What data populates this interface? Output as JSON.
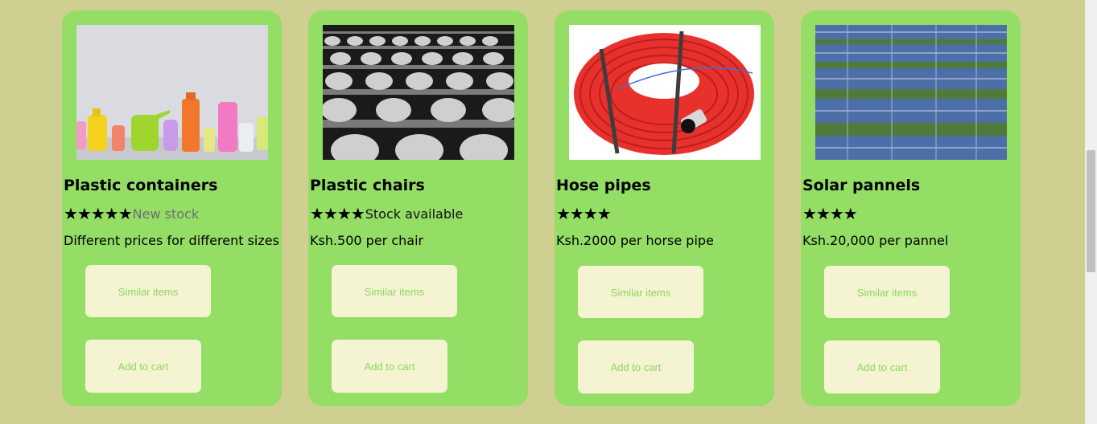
{
  "colors": {
    "page_bg": "#cfcf91",
    "card_bg": "#94de66",
    "button_bg": "#f4f4d2",
    "button_text": "#8ed660",
    "muted_text": "#6f6f6f"
  },
  "products": [
    {
      "title": "Plastic containers",
      "stars": "★★★★★",
      "star_count": 5,
      "stock": "New stock",
      "stock_muted": true,
      "price": "Different prices for different sizes",
      "similar_label": "Similar items",
      "cart_label": "Add to cart",
      "image": "plastic-containers-photo"
    },
    {
      "title": "Plastic chairs",
      "stars": "★★★★",
      "star_count": 4,
      "stock": "Stock available",
      "stock_muted": false,
      "price": "Ksh.500 per chair",
      "similar_label": "Similar items",
      "cart_label": "Add to cart",
      "image": "plastic-chairs-photo"
    },
    {
      "title": "Hose pipes",
      "stars": "★★★★",
      "star_count": 4,
      "stock": "",
      "stock_muted": false,
      "price": "Ksh.2000 per horse pipe",
      "similar_label": "Similar items",
      "cart_label": "Add to cart",
      "image": "hose-pipe-photo"
    },
    {
      "title": "Solar pannels",
      "stars": "★★★★",
      "star_count": 4,
      "stock": "",
      "stock_muted": false,
      "price": "Ksh.20,000 per pannel",
      "similar_label": "Similar items",
      "cart_label": "Add to cart",
      "image": "solar-panels-photo"
    }
  ]
}
